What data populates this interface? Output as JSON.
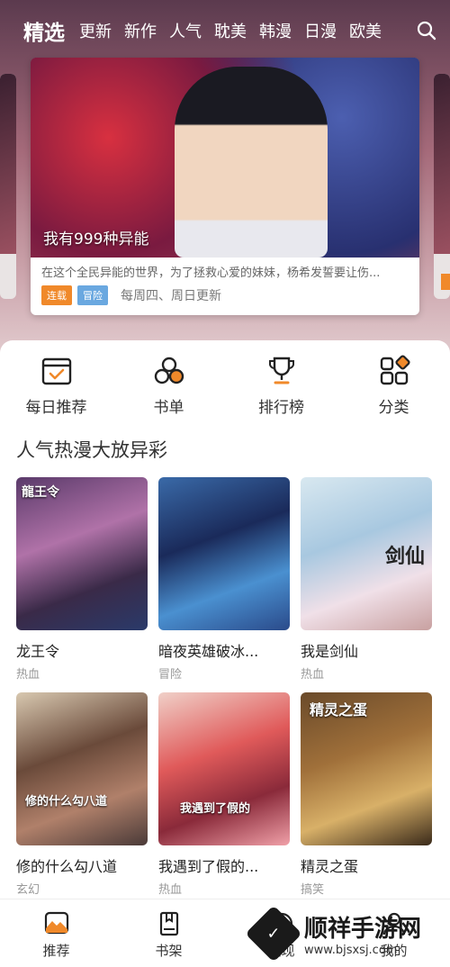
{
  "top_nav": {
    "tabs": [
      "精选",
      "更新",
      "新作",
      "人气",
      "耽美",
      "韩漫",
      "日漫",
      "欧美"
    ]
  },
  "banner": {
    "title": "我有999种异能",
    "description": "在这个全民异能的世界，为了拯救心爱的妹妹，杨希发誓要让伤...",
    "badges": [
      "连载",
      "冒险"
    ],
    "schedule": "每周四、周日更新"
  },
  "quick_links": [
    {
      "label": "每日推荐",
      "icon": "calendar-check-icon"
    },
    {
      "label": "书单",
      "icon": "circles-icon"
    },
    {
      "label": "排行榜",
      "icon": "trophy-icon"
    },
    {
      "label": "分类",
      "icon": "grid-diamond-icon"
    }
  ],
  "section": {
    "title": "人气热漫大放异彩"
  },
  "comics": [
    {
      "name": "龙王令",
      "genre": "热血",
      "cover_text": "龍王令"
    },
    {
      "name": "暗夜英雄破冰...",
      "genre": "冒险",
      "cover_text": ""
    },
    {
      "name": "我是剑仙",
      "genre": "热血",
      "cover_text": "剑仙"
    },
    {
      "name": "修的什么勾八道",
      "genre": "玄幻",
      "cover_text": "修的什么勾八道"
    },
    {
      "name": "我遇到了假的...",
      "genre": "热血",
      "cover_text": "我遇到了假的"
    },
    {
      "name": "精灵之蛋",
      "genre": "搞笑",
      "cover_text": "精灵之蛋"
    }
  ],
  "tab_bar": [
    {
      "label": "推荐",
      "icon": "recommend-icon"
    },
    {
      "label": "书架",
      "icon": "bookshelf-icon"
    },
    {
      "label": "发现",
      "icon": "discover-icon"
    },
    {
      "label": "我的",
      "icon": "profile-icon"
    }
  ],
  "watermark": {
    "main": "顺祥手游网",
    "sub": "www.bjsxsj.com"
  },
  "colors": {
    "accent_orange": "#f0892a",
    "accent_blue": "#6aa8e0"
  }
}
